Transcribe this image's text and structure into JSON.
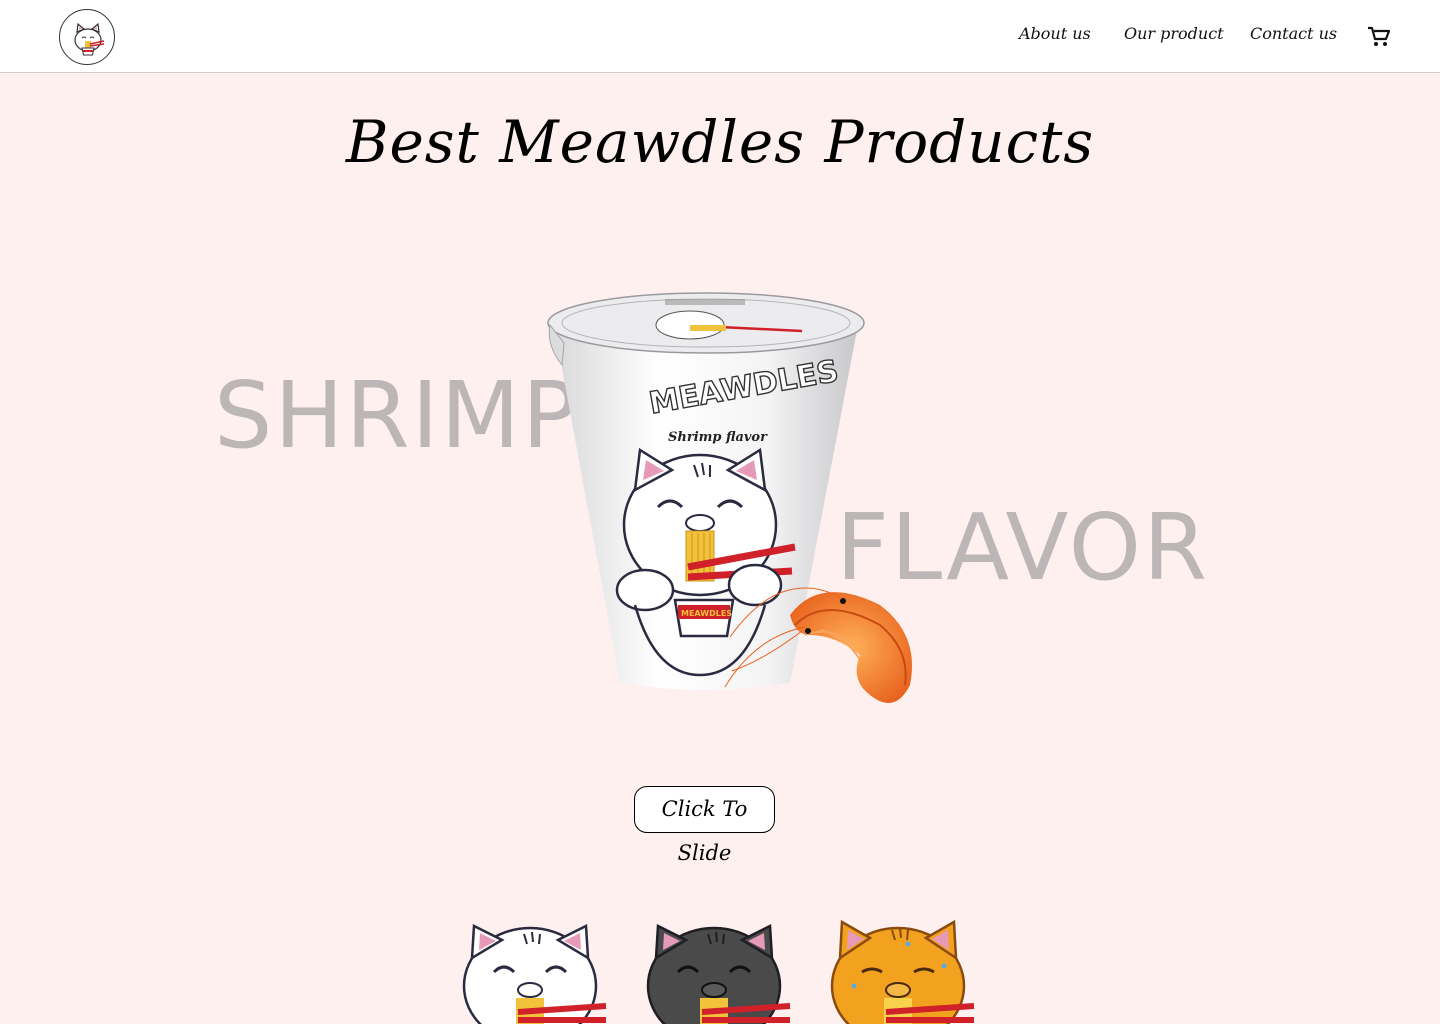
{
  "header": {
    "logo_icon": "meawdles-cat-logo-icon",
    "nav": [
      {
        "label": "About us"
      },
      {
        "label": "Our product"
      },
      {
        "label": "Contact us"
      }
    ],
    "cart_icon": "shopping-cart-icon"
  },
  "main": {
    "title": "Best Meawdles Products",
    "flavor_words": [
      "SHRIMP",
      "FLAVOR"
    ],
    "product": {
      "brand": "MEAWDLES",
      "flavor_label": "Shrimp flavor",
      "mini_cup_label": "MEAWDLES"
    },
    "slide_button_label": "Click To Slide",
    "thumbnails": [
      {
        "variant": "white-cat-icon"
      },
      {
        "variant": "black-cat-icon"
      },
      {
        "variant": "orange-cat-icon"
      }
    ]
  },
  "colors": {
    "background": "#fff0f0",
    "header_bg": "#ffffff",
    "flavor_word": "#bdb6b6",
    "chopsticks": "#d0202a",
    "noodles": "#f2c23a",
    "shrimp": "#f07a2a"
  }
}
